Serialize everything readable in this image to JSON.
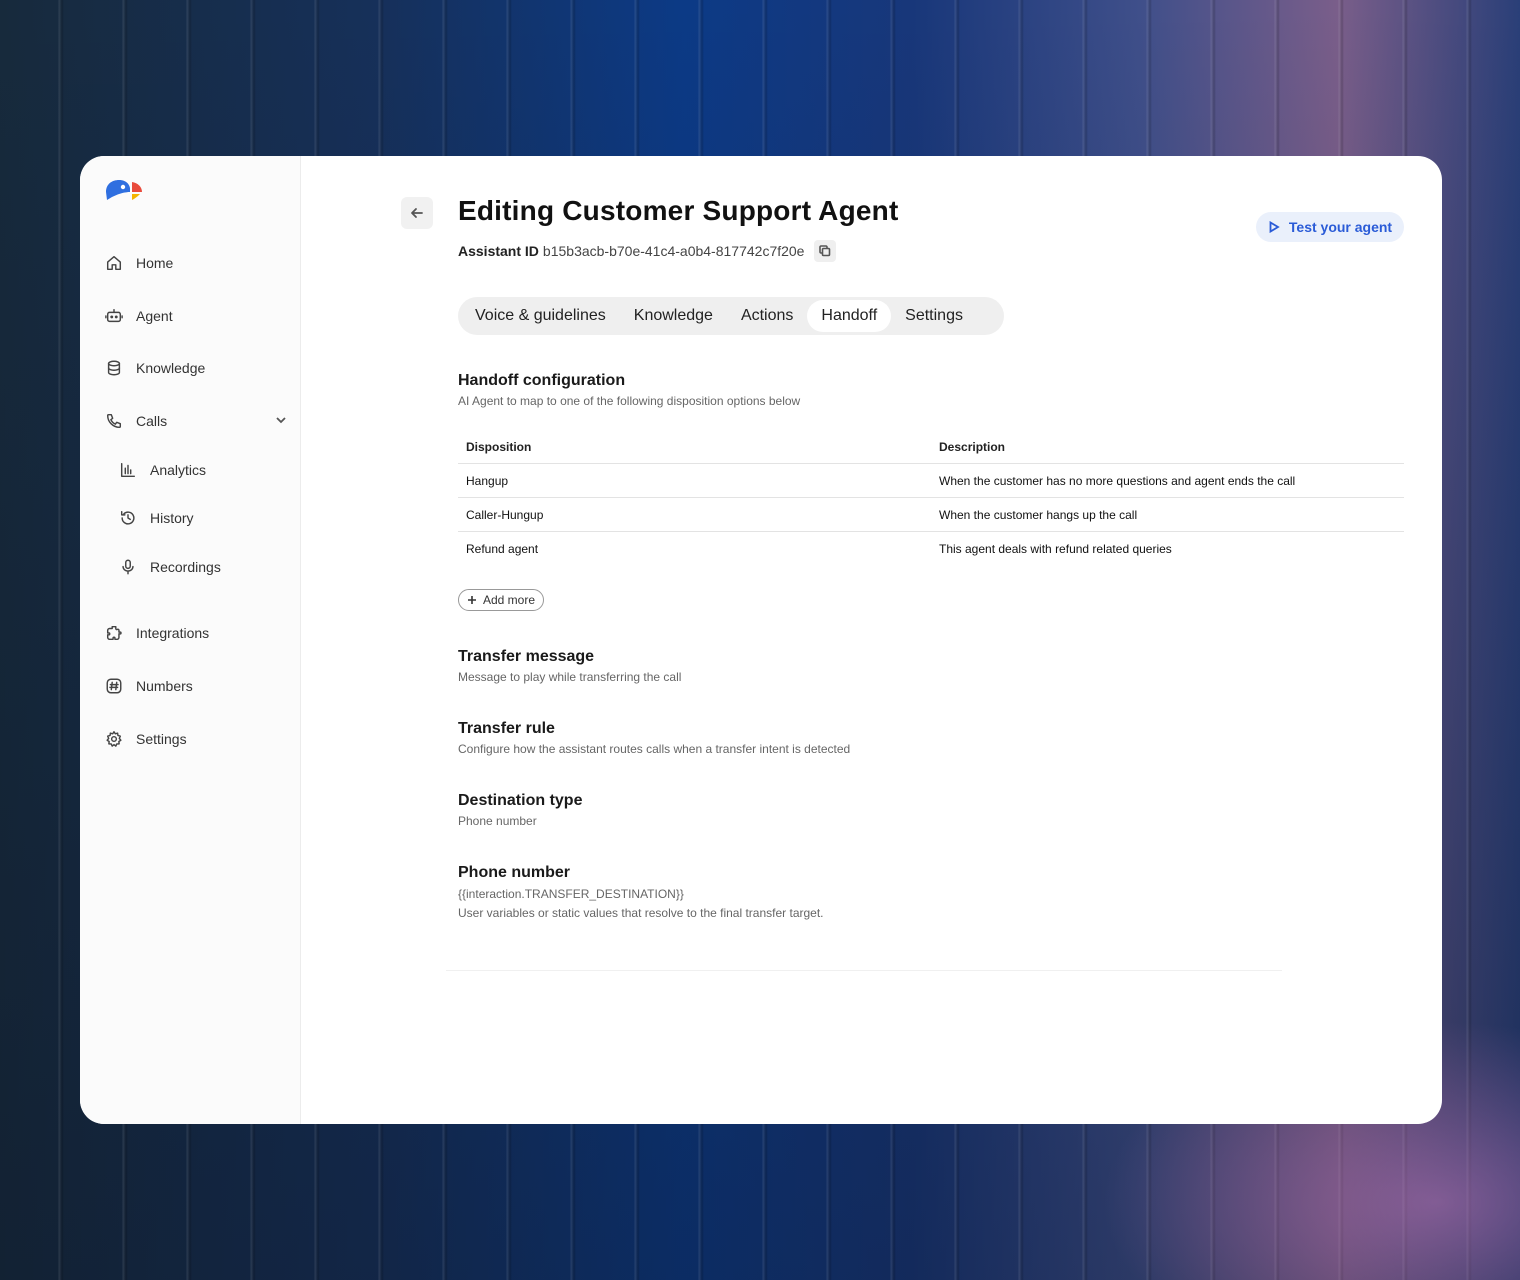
{
  "nav": {
    "home": "Home",
    "agent": "Agent",
    "knowledge": "Knowledge",
    "calls": "Calls",
    "analytics": "Analytics",
    "history": "History",
    "recordings": "Recordings",
    "integrations": "Integrations",
    "numbers": "Numbers",
    "settings": "Settings"
  },
  "header": {
    "title": "Editing Customer Support Agent",
    "assistant_id_label": "Assistant ID",
    "assistant_id": "b15b3acb-b70e-41c4-a0b4-817742c7f20e",
    "test_button": "Test your agent"
  },
  "tabs": [
    {
      "label": "Voice & guidelines"
    },
    {
      "label": "Knowledge"
    },
    {
      "label": "Actions"
    },
    {
      "label": "Handoff"
    },
    {
      "label": "Settings"
    }
  ],
  "active_tab": "Handoff",
  "handoff": {
    "title": "Handoff configuration",
    "subtitle": "AI Agent to map to one of the following disposition options below",
    "columns": [
      "Disposition",
      "Description"
    ],
    "rows": [
      {
        "disposition": "Hangup",
        "description": "When the customer has no more questions and agent ends the call"
      },
      {
        "disposition": "Caller-Hungup",
        "description": "When the customer hangs up the call"
      },
      {
        "disposition": "Refund agent",
        "description": "This agent deals with refund related queries"
      }
    ],
    "add_more": "Add more"
  },
  "transfer_message": {
    "title": "Transfer message",
    "subtitle": "Message to play while transferring the call"
  },
  "transfer_rule": {
    "title": "Transfer rule",
    "subtitle": "Configure how the assistant routes calls when a transfer intent is detected"
  },
  "destination_type": {
    "title": "Destination type",
    "value": "Phone number"
  },
  "phone_number": {
    "title": "Phone number",
    "value": "{{interaction.TRANSFER_DESTINATION}}",
    "hint": "User variables or static values that resolve to the final transfer target."
  },
  "colors": {
    "accent": "#2a5bd7",
    "accent_bg": "#eaf0fb",
    "logo_blue": "#2f6fe0",
    "logo_red": "#e94b3c",
    "logo_yellow": "#f4b400"
  }
}
